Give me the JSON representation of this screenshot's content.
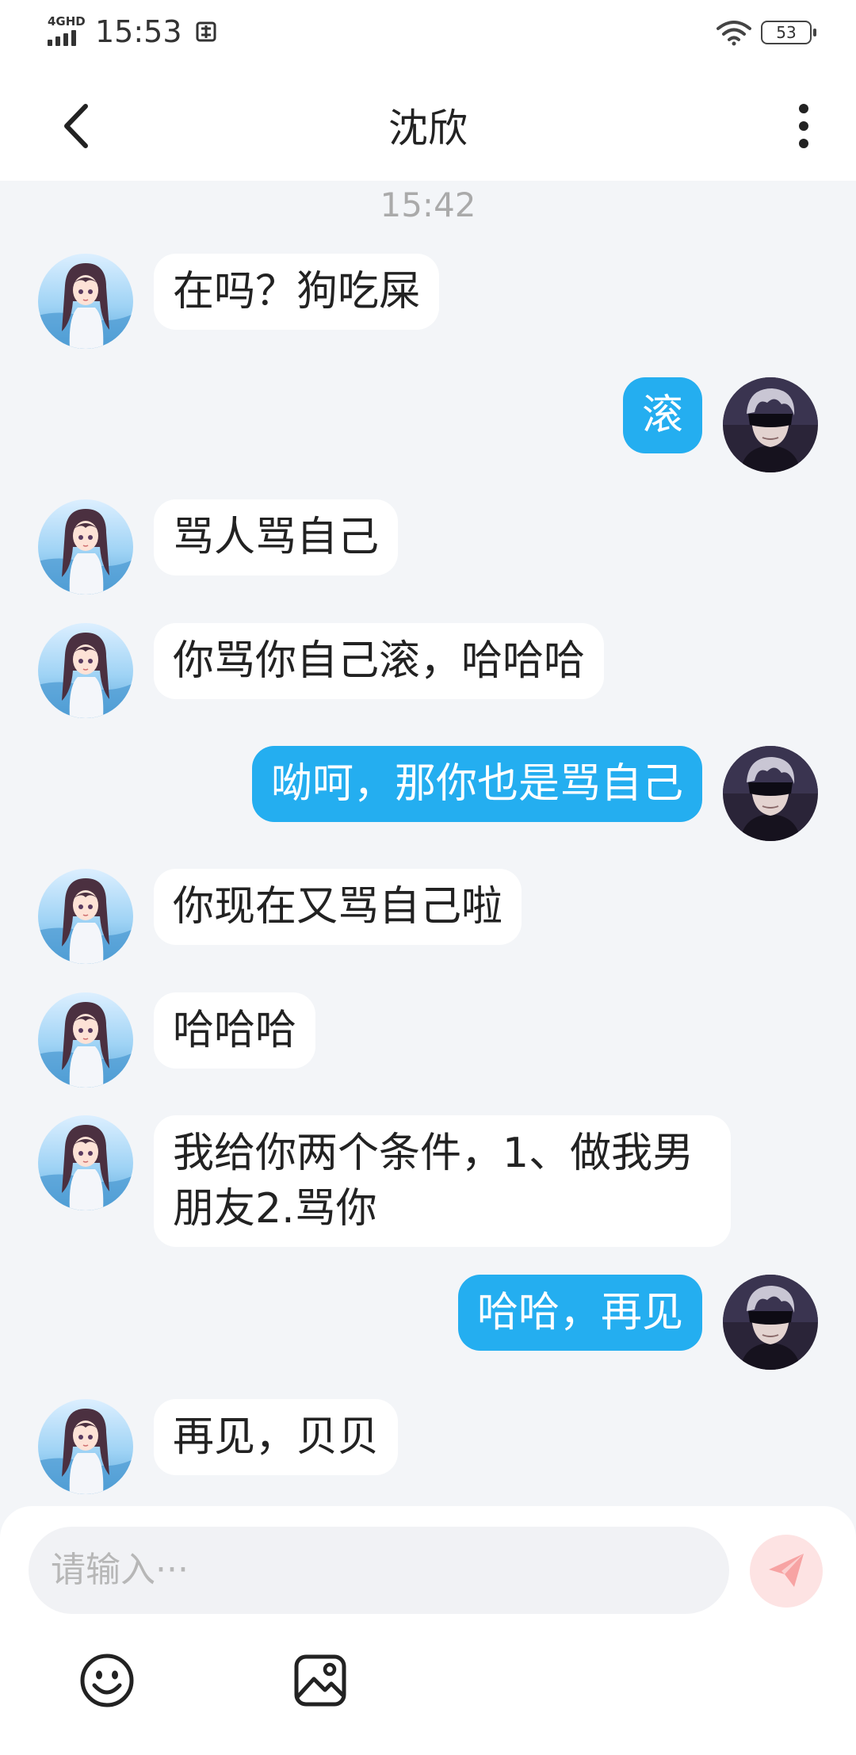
{
  "status_bar": {
    "network": "4GHD",
    "time": "15:53",
    "battery": "53"
  },
  "header": {
    "title": "沈欣"
  },
  "chat": {
    "timestamp": "15:42",
    "messages": [
      {
        "side": "left",
        "text": "在吗？狗吃屎"
      },
      {
        "side": "right",
        "text": "滚"
      },
      {
        "side": "left",
        "text": "骂人骂自己"
      },
      {
        "side": "left",
        "text": "你骂你自己滚，哈哈哈"
      },
      {
        "side": "right",
        "text": "呦呵，那你也是骂自己"
      },
      {
        "side": "left",
        "text": "你现在又骂自己啦"
      },
      {
        "side": "left",
        "text": "哈哈哈"
      },
      {
        "side": "left",
        "text": "我给你两个条件，1、做我男朋友2.骂你"
      },
      {
        "side": "right",
        "text": "哈哈，再见"
      },
      {
        "side": "left",
        "text": "再见，贝贝"
      }
    ]
  },
  "input": {
    "placeholder": "请输入···"
  },
  "colors": {
    "sent_bubble": "#24aef0",
    "received_bubble": "#ffffff",
    "send_button_bg": "#fde3e3",
    "send_icon": "#f7a3a3",
    "background": "#f3f5f8"
  },
  "icons": {
    "back": "chevron-left-icon",
    "more": "more-vertical-icon",
    "send": "send-icon",
    "emoji": "emoji-icon",
    "image": "image-icon"
  }
}
